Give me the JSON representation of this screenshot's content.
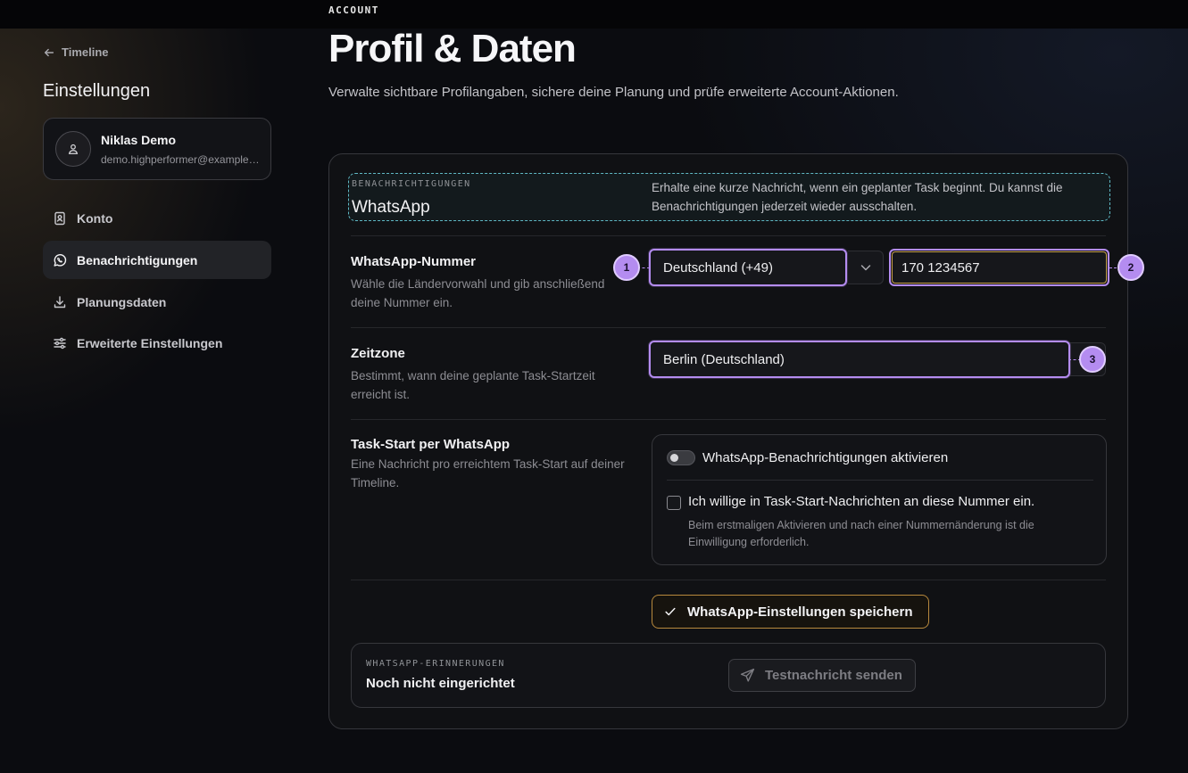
{
  "header": {
    "eyebrow": "ACCOUNT",
    "title": "Profil & Daten",
    "description": "Verwalte sichtbare Profilangaben, sichere deine Planung und prüfe erweiterte Account-Aktionen."
  },
  "sidebar": {
    "back_label": "Timeline",
    "title": "Einstellungen",
    "profile": {
      "name": "Niklas Demo",
      "email": "demo.highperformer@example.com"
    },
    "items": [
      {
        "label": "Konto",
        "icon": "contact-card-icon",
        "active": false
      },
      {
        "label": "Benachrichtigungen",
        "icon": "whatsapp-icon",
        "active": true
      },
      {
        "label": "Planungsdaten",
        "icon": "download-icon",
        "active": false
      },
      {
        "label": "Erweiterte Einstellungen",
        "icon": "sliders-icon",
        "active": false
      }
    ]
  },
  "section": {
    "eyebrow": "BENACHRICHTIGUNGEN",
    "title": "WhatsApp",
    "description": "Erhalte eine kurze Nachricht, wenn ein geplanter Task beginnt. Du kannst die Benachrichtigungen jederzeit wieder ausschalten."
  },
  "phone_row": {
    "title": "WhatsApp-Nummer",
    "description": "Wähle die Ländervorwahl und gib anschließend deine Nummer ein.",
    "country_value": "Deutschland (+49)",
    "number_value": "170 1234567"
  },
  "timezone_row": {
    "title": "Zeitzone",
    "description": "Bestimmt, wann deine geplante Task-Startzeit erreicht ist.",
    "value": "Berlin (Deutschland)"
  },
  "task_row": {
    "title": "Task-Start per WhatsApp",
    "description": "Eine Nachricht pro erreichtem Task-Start auf deiner Timeline.",
    "toggle_label": "WhatsApp-Benachrichtigungen aktivieren",
    "toggle_on": false,
    "consent_label": "Ich willige in Task-Start-Nachrichten an diese Nummer ein.",
    "consent_checked": false,
    "consent_hint": "Beim erstmaligen Aktivieren und nach einer Nummernänderung ist die Einwilligung erforderlich."
  },
  "save_button": "WhatsApp-Einstellungen speichern",
  "reminders": {
    "eyebrow": "WHATSAPP-ERINNERUNGEN",
    "status": "Noch nicht eingerichtet",
    "test_button": "Testnachricht senden"
  },
  "markers": [
    "1",
    "2",
    "3"
  ],
  "colors": {
    "accent_purple": "#b48cf0",
    "save_border": "#b8893d",
    "dashed_cyan": "#5fb8c4"
  }
}
